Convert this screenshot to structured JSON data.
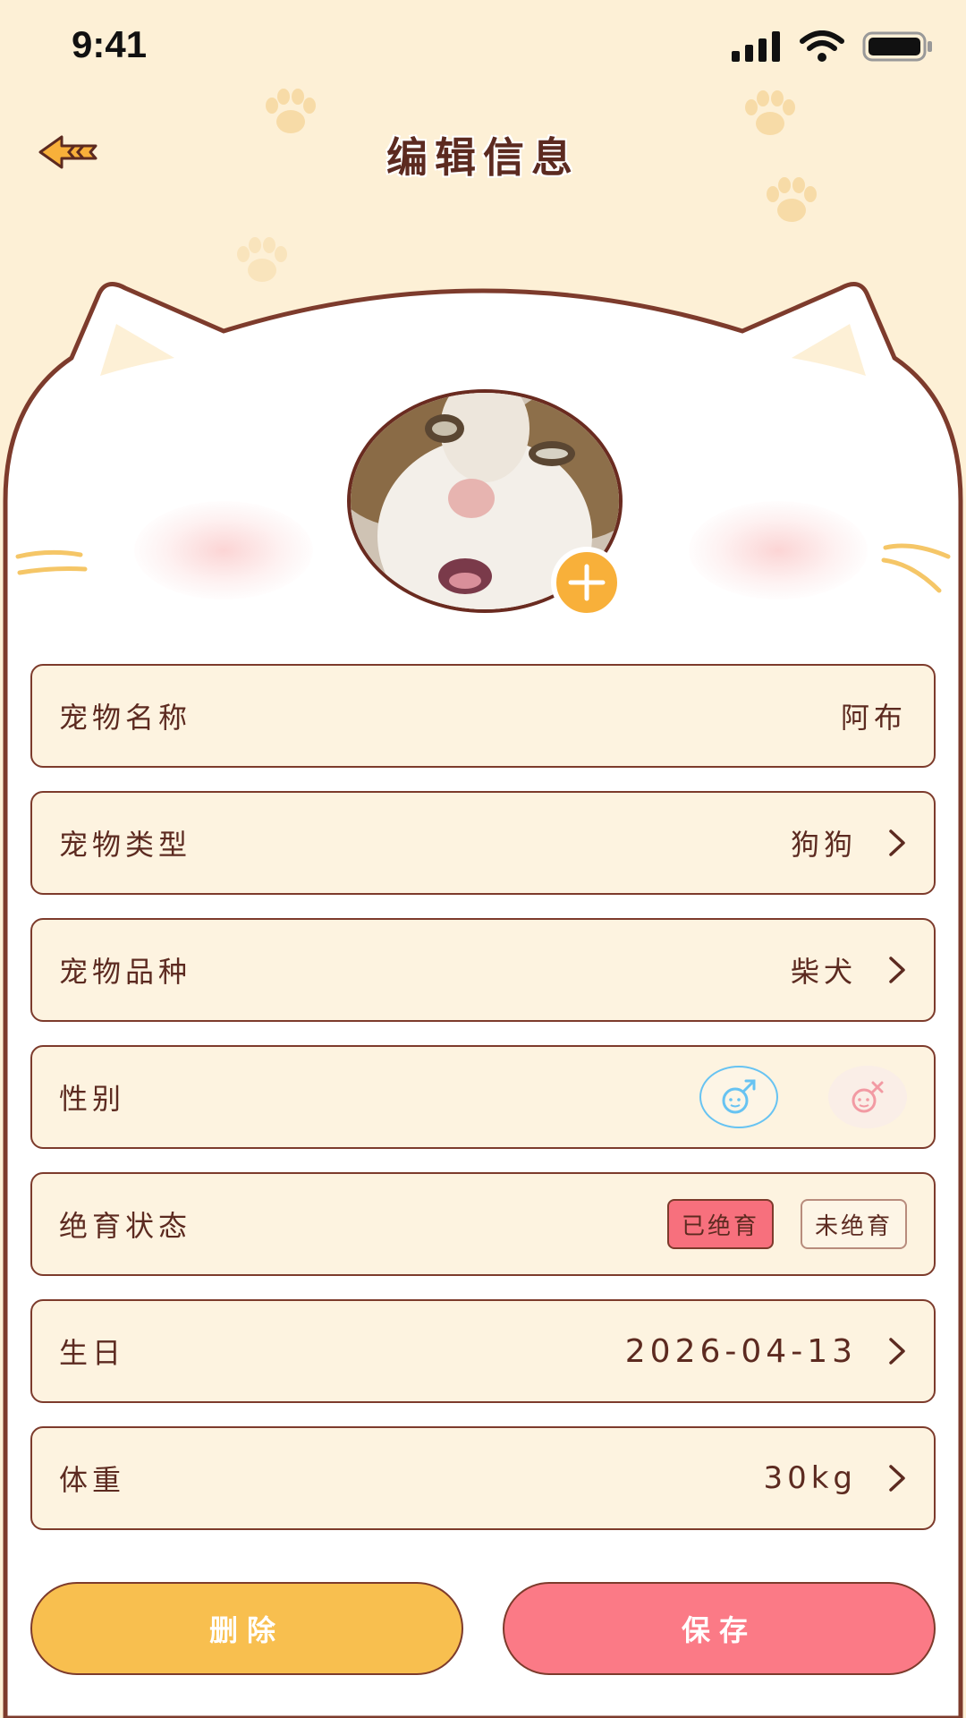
{
  "status_bar": {
    "time": "9:41"
  },
  "header": {
    "title": "编辑信息"
  },
  "colors": {
    "background": "#fdf0d6",
    "accent_orange": "#f8b03a",
    "accent_pink": "#fb7a86",
    "border_brown": "#7d3b2c",
    "male_blue": "#67c3f2"
  },
  "form": {
    "name": {
      "label": "宠物名称",
      "value": "阿布"
    },
    "type": {
      "label": "宠物类型",
      "value": "狗狗"
    },
    "breed": {
      "label": "宠物品种",
      "value": "柴犬"
    },
    "gender": {
      "label": "性别",
      "selected": "male"
    },
    "neuter": {
      "label": "绝育状态",
      "options": [
        "已绝育",
        "未绝育"
      ],
      "selected": "已绝育"
    },
    "birthday": {
      "label": "生日",
      "value": "2026-04-13"
    },
    "weight": {
      "label": "体重",
      "value": "30kg"
    }
  },
  "actions": {
    "delete_label": "删除",
    "save_label": "保存"
  },
  "icons": [
    "back-arrow-icon",
    "plus-icon",
    "chevron-right-icon",
    "male-icon",
    "female-icon",
    "paw-icon",
    "signal-icon",
    "wifi-icon",
    "battery-icon"
  ]
}
